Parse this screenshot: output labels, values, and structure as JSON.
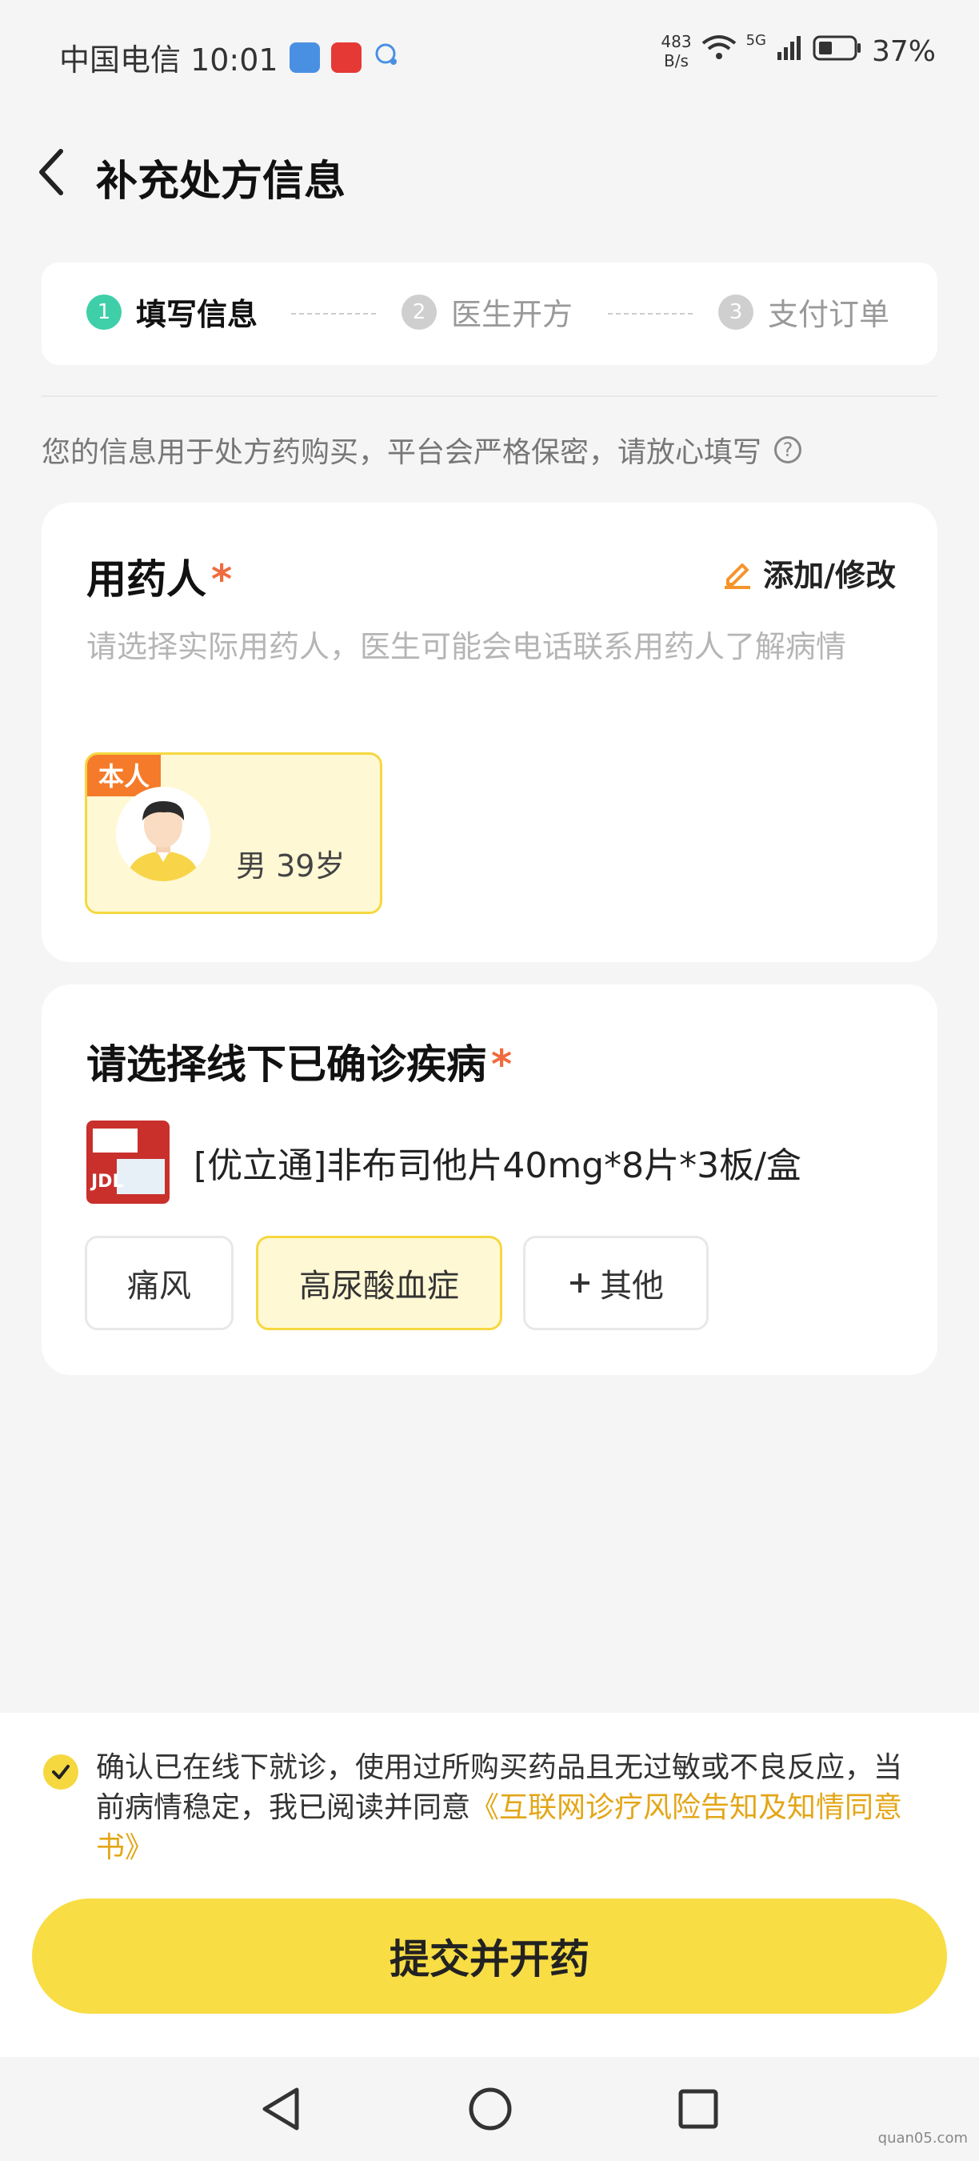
{
  "status": {
    "carrier_time": "中国电信 10:01",
    "net_speed_value": "483",
    "net_speed_unit": "B/s",
    "signal": "5G",
    "battery": "37%"
  },
  "header": {
    "title": "补充处方信息"
  },
  "stepper": {
    "steps": [
      {
        "num": "1",
        "label": "填写信息"
      },
      {
        "num": "2",
        "label": "医生开方"
      },
      {
        "num": "3",
        "label": "支付订单"
      }
    ]
  },
  "notice": "您的信息用于处方药购买，平台会严格保密，请放心填写",
  "patient_section": {
    "title": "用药人",
    "required_mark": "*",
    "edit_label": "添加/修改",
    "hint": "请选择实际用药人，医生可能会电话联系用药人了解病情",
    "patient": {
      "tag": "本人",
      "info": "男 39岁"
    }
  },
  "disease_section": {
    "title": "请选择线下已确诊疾病",
    "required_mark": "*",
    "drug_name": "[优立通]非布司他片40mg*8片*3板/盒",
    "drug_img_text": "JDL",
    "tags": [
      "痛风",
      "高尿酸血症",
      "其他"
    ]
  },
  "agreement": {
    "text": "确认已在线下就诊，使用过所购买药品且无过敏或不良反应，当前病情稳定，我已阅读并同意",
    "link": "《互联网诊疗风险告知及知情同意书》"
  },
  "submit_label": "提交并开药",
  "watermark": "quan05.com",
  "colors": {
    "accent_yellow": "#f8dd45",
    "step_active": "#3ecfa8",
    "step_inactive": "#cfcfcf",
    "required": "#f06b3e",
    "tag_orange": "#f57b2a",
    "link": "#e3a617"
  }
}
